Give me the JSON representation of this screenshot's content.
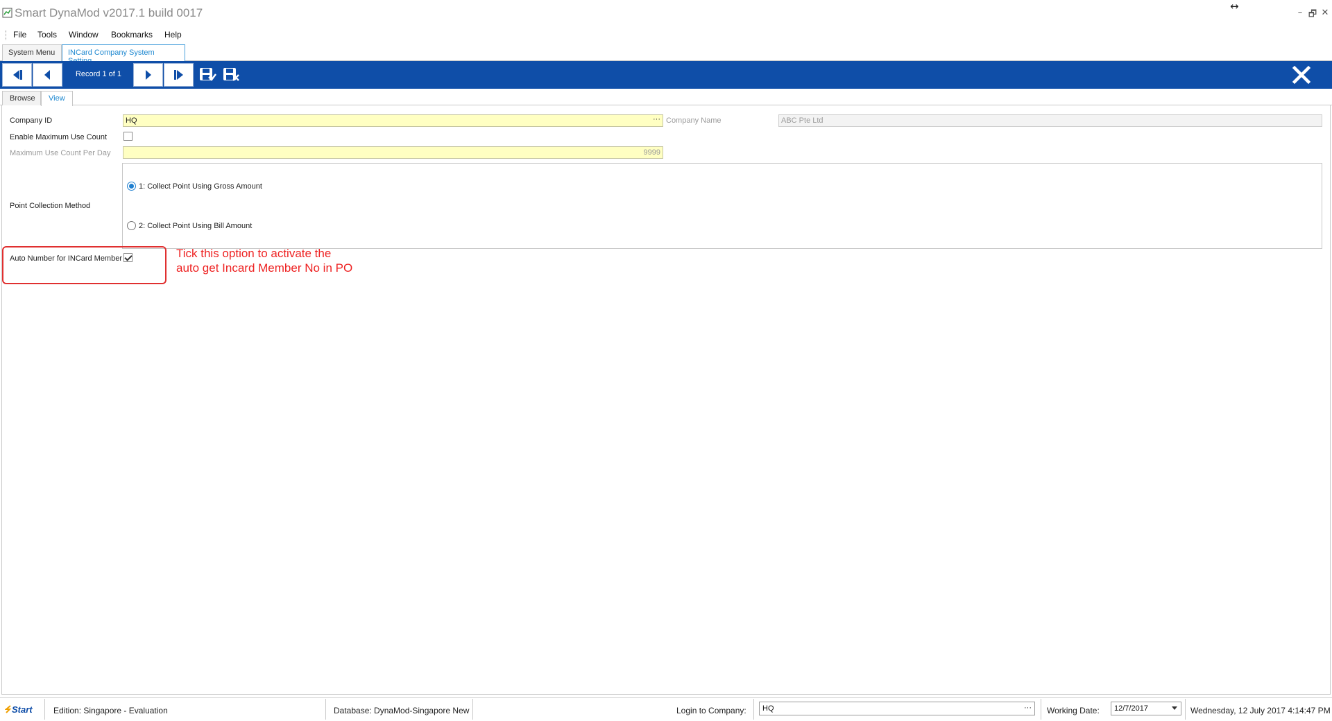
{
  "window": {
    "title": "Smart DynaMod v2017.1 build 0017",
    "resize_glyph": "↔",
    "minimize": "–",
    "restore": "🗗",
    "close": "✕"
  },
  "menu": {
    "items": [
      "File",
      "Tools",
      "Window",
      "Bookmarks",
      "Help"
    ]
  },
  "doc_tabs": [
    {
      "label": "System Menu",
      "active": false
    },
    {
      "label": "INCard Company System Setting",
      "active": true
    }
  ],
  "toolbar": {
    "record_text": "Record 1 of 1",
    "icons": [
      "first-record-icon",
      "previous-record-icon",
      "next-record-icon",
      "last-record-icon",
      "save-icon",
      "save-close-icon",
      "close-icon"
    ],
    "bg_color": "#0f4ea8"
  },
  "view_tabs": [
    {
      "label": "Browse",
      "active": false
    },
    {
      "label": "View",
      "active": true
    }
  ],
  "form": {
    "company_id_label": "Company ID",
    "company_id_value": "HQ",
    "company_id_button": "···",
    "company_name_label": "Company Name",
    "company_name_value": "ABC Pte Ltd",
    "enable_max_label": "Enable Maximum Use Count",
    "enable_max_checked": false,
    "max_per_day_label": "Maximum Use Count Per Day",
    "max_per_day_value": "9999",
    "point_method_label": "Point Collection Method",
    "point_options": [
      {
        "label": "1: Collect Point Using Gross Amount",
        "selected": true
      },
      {
        "label": "2: Collect Point Using Bill Amount",
        "selected": false
      }
    ],
    "auto_number_label": "Auto Number for INCard Member",
    "auto_number_checked": true
  },
  "annotation": {
    "line1": "Tick this option to activate the",
    "line2": "auto get Incard Member No in PO",
    "color": "#ee2222"
  },
  "status": {
    "logo": "Start",
    "edition": "Edition: Singapore - Evaluation",
    "database": "Database: DynaMod-Singapore New",
    "login_label": "Login to Company:",
    "login_value": "HQ",
    "login_button": "···",
    "working_date_label": "Working Date:",
    "working_date_value": "12/7/2017",
    "datetime": "Wednesday, 12 July 2017 4:14:47 PM"
  }
}
